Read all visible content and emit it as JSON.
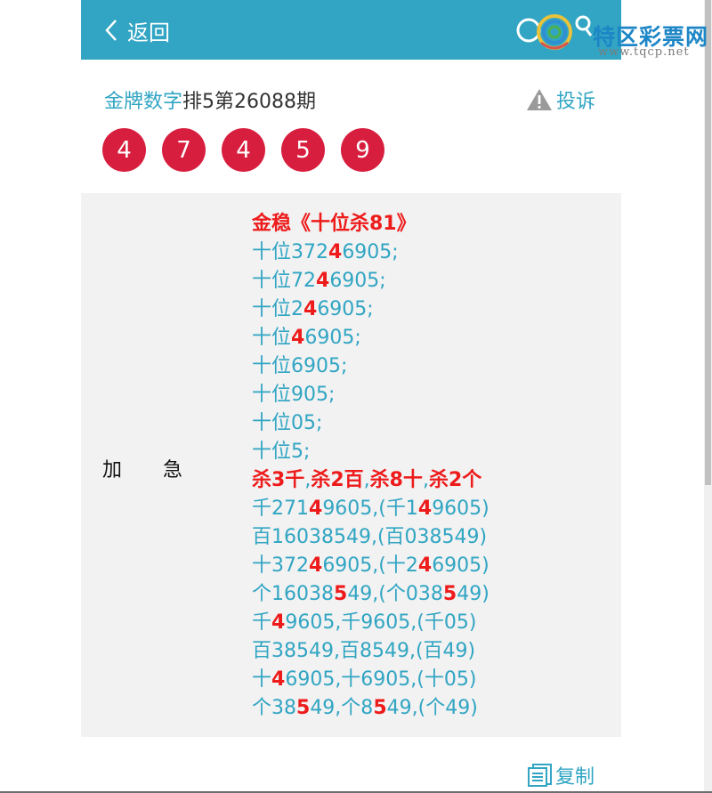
{
  "header": {
    "back_label": "返回",
    "logo_text": "特区彩票网",
    "logo_url": "www.tqcp.net"
  },
  "title": {
    "link": "金牌数字",
    "rest": "排5第26088期"
  },
  "complain_label": "投诉",
  "balls": [
    "4",
    "7",
    "4",
    "5",
    "9"
  ],
  "side_label": [
    "加",
    "急"
  ],
  "lines": [
    {
      "type": "heading",
      "segments": [
        {
          "t": "金稳《十位杀81》"
        }
      ]
    },
    {
      "type": "normal",
      "segments": [
        {
          "t": "十位372"
        },
        {
          "t": "4",
          "hl": true
        },
        {
          "t": "6905;"
        }
      ]
    },
    {
      "type": "normal",
      "segments": [
        {
          "t": "十位72"
        },
        {
          "t": "4",
          "hl": true
        },
        {
          "t": "6905;"
        }
      ]
    },
    {
      "type": "normal",
      "segments": [
        {
          "t": "十位2"
        },
        {
          "t": "4",
          "hl": true
        },
        {
          "t": "6905;"
        }
      ]
    },
    {
      "type": "normal",
      "segments": [
        {
          "t": "十位"
        },
        {
          "t": "4",
          "hl": true
        },
        {
          "t": "6905;"
        }
      ]
    },
    {
      "type": "normal",
      "segments": [
        {
          "t": "十位6905;"
        }
      ]
    },
    {
      "type": "normal",
      "segments": [
        {
          "t": "十位905;"
        }
      ]
    },
    {
      "type": "normal",
      "segments": [
        {
          "t": "十位05;"
        }
      ]
    },
    {
      "type": "normal",
      "segments": [
        {
          "t": "十位5;"
        }
      ]
    },
    {
      "type": "heading",
      "segments": [
        {
          "t": "杀3千"
        },
        {
          "t": ",",
          "sep": true
        },
        {
          "t": "杀2百"
        },
        {
          "t": ",",
          "sep": true
        },
        {
          "t": "杀8十"
        },
        {
          "t": ",",
          "sep": true
        },
        {
          "t": "杀2个"
        }
      ]
    },
    {
      "type": "normal",
      "segments": [
        {
          "t": "千271"
        },
        {
          "t": "4",
          "hl": true
        },
        {
          "t": "9605,(千1"
        },
        {
          "t": "4",
          "hl": true
        },
        {
          "t": "9605)"
        }
      ]
    },
    {
      "type": "normal",
      "segments": [
        {
          "t": "百16038549,(百038549)"
        }
      ]
    },
    {
      "type": "normal",
      "segments": [
        {
          "t": "十372"
        },
        {
          "t": "4",
          "hl": true
        },
        {
          "t": "6905,(十2"
        },
        {
          "t": "4",
          "hl": true
        },
        {
          "t": "6905)"
        }
      ]
    },
    {
      "type": "normal",
      "segments": [
        {
          "t": "个1603"
        },
        {
          "t": "85",
          "mixed": true
        },
        {
          "t": "49,(个03"
        },
        {
          "t": "85",
          "mixed": true
        },
        {
          "t": "49)"
        }
      ]
    },
    {
      "type": "normal",
      "segments": [
        {
          "t": "千"
        },
        {
          "t": "4",
          "hl": true
        },
        {
          "t": "9605,千9605,(千05)"
        }
      ]
    },
    {
      "type": "normal",
      "segments": [
        {
          "t": "百38549,百8549,(百49)"
        }
      ]
    },
    {
      "type": "normal",
      "segments": [
        {
          "t": "十"
        },
        {
          "t": "4",
          "hl": true
        },
        {
          "t": "6905,十6905,(十05)"
        }
      ]
    },
    {
      "type": "normal",
      "segments": [
        {
          "t": "个38"
        },
        {
          "t": "5",
          "hl": true
        },
        {
          "t": "49,个8"
        },
        {
          "t": "5",
          "hl": true
        },
        {
          "t": "49,(个49)"
        }
      ]
    }
  ],
  "copy_label": "复制",
  "colors": {
    "header": "#31a5c3",
    "accent": "#31a5c3",
    "ball": "#d81e3e",
    "highlight": "#ee1b1b",
    "content_bg": "#f2f2f2"
  }
}
